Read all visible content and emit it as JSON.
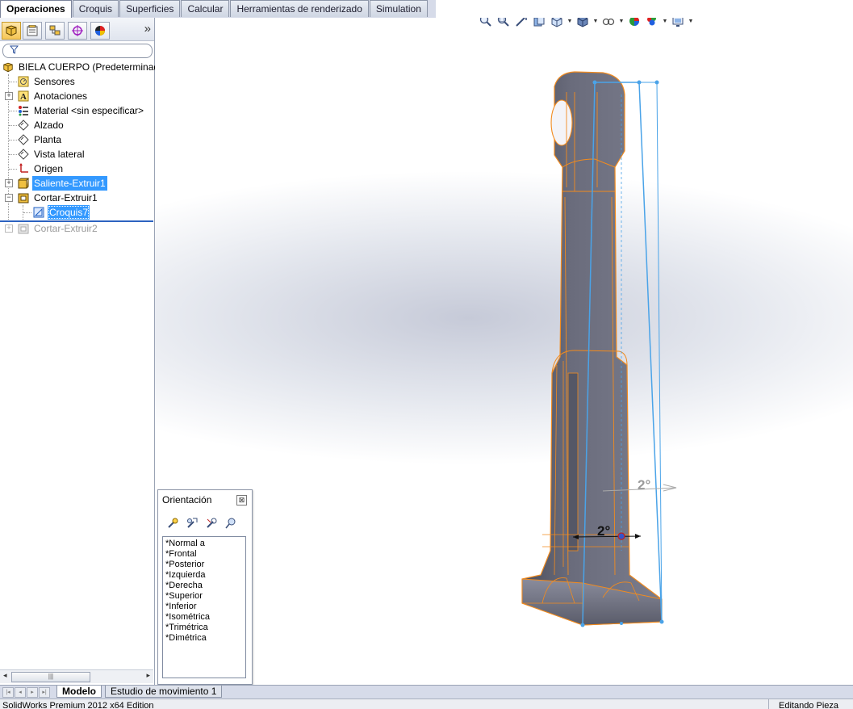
{
  "command_tabs": [
    "Operaciones",
    "Croquis",
    "Superficies",
    "Calcular",
    "Herramientas de renderizado",
    "Simulation"
  ],
  "panel_tools": {
    "more": "»",
    "icons": [
      "feature-manager-icon",
      "property-manager-icon",
      "configuration-manager-icon",
      "dimxpert-icon",
      "display-manager-icon"
    ]
  },
  "tree": {
    "root": "BIELA CUERPO  (Predeterminad",
    "items": [
      {
        "label": "Sensores"
      },
      {
        "label": "Anotaciones"
      },
      {
        "label": "Material <sin especificar>"
      },
      {
        "label": "Alzado"
      },
      {
        "label": "Planta"
      },
      {
        "label": "Vista lateral"
      },
      {
        "label": "Origen"
      },
      {
        "label": "Saliente-Extruir1"
      },
      {
        "label": "Cortar-Extruir1"
      },
      {
        "label": "Croquis7"
      },
      {
        "label": "Cortar-Extruir2"
      }
    ]
  },
  "viewport": {
    "dimension_1": "2°",
    "dimension_2": "2°",
    "edge_color": "#f28b1e",
    "sketch_color": "#4aa3e8",
    "body_color": "#5e6070"
  },
  "orientation": {
    "title": "Orientación",
    "close": "⊠",
    "views": [
      "*Normal a",
      "*Frontal",
      "*Posterior",
      "*Izquierda",
      "*Derecha",
      "*Superior",
      "*Inferior",
      "*Isométrica",
      "*Trimétrica",
      "*Dimétrica"
    ]
  },
  "bottom_tabs": [
    "Modelo",
    "Estudio de movimiento 1"
  ],
  "status": {
    "left": "SolidWorks Premium 2012 x64 Edition",
    "right": "Editando Pieza"
  }
}
